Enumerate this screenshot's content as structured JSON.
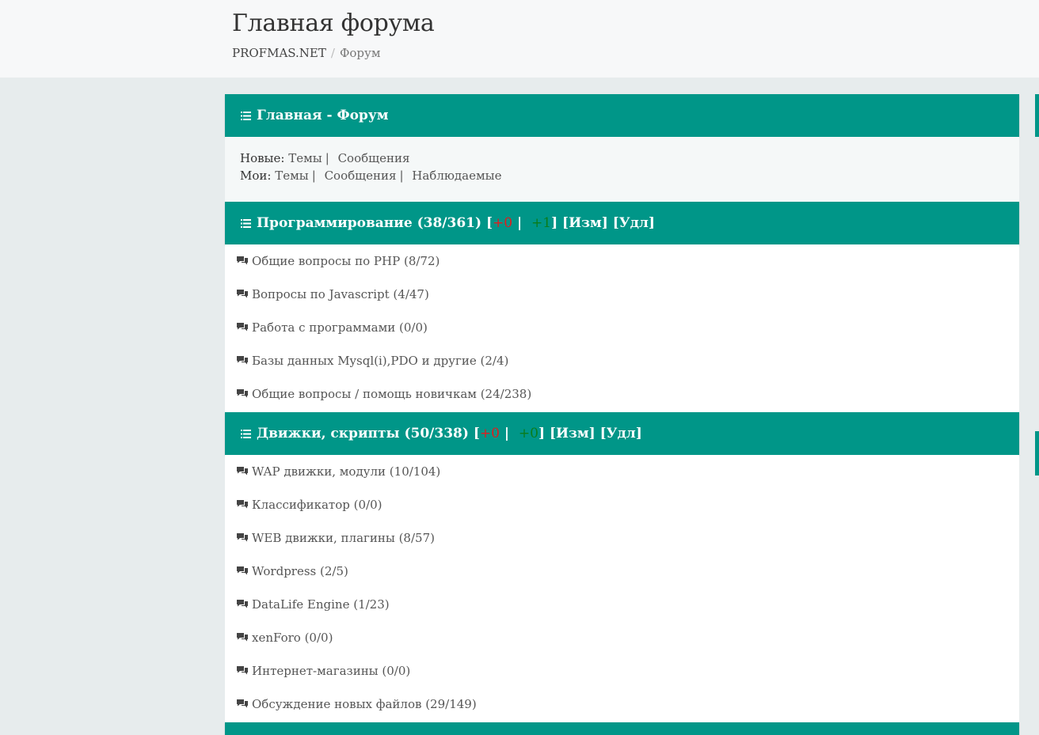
{
  "header": {
    "title": "Главная форума",
    "breadcrumb": {
      "root": "PROFMAS.NET",
      "sep": "/",
      "current": "Форум"
    }
  },
  "main_panel": {
    "title": "Главная - Форум",
    "new_label": "Новые:",
    "new_links": [
      "Темы",
      "Сообщения"
    ],
    "my_label": "Мои:",
    "my_links": [
      "Темы",
      "Сообщения",
      "Наблюдаемые"
    ]
  },
  "categories": [
    {
      "title": "Программирование (38/361)",
      "plus_red": "+0",
      "plus_green": "+1",
      "edit": "[Изм]",
      "delete": "[Удл]",
      "forums": [
        "Общие вопросы по PHP (8/72)",
        "Вопросы по Javascript (4/47)",
        "Работа с программами (0/0)",
        "Базы данных Mysql(i),PDO и другие (2/4)",
        "Общие вопросы / помощь новичкам (24/238)"
      ]
    },
    {
      "title": "Движки, скрипты (50/338)",
      "plus_red": "+0",
      "plus_green": "+0",
      "edit": "[Изм]",
      "delete": "[Удл]",
      "forums": [
        "WAP движки, модули (10/104)",
        "Классификатор (0/0)",
        "WEB движки, плагины (8/57)",
        "Wordpress (2/5)",
        "DataLife Engine (1/23)",
        "xenForo (0/0)",
        "Интернет-магазины (0/0)",
        "Обсуждение новых файлов (29/149)"
      ]
    }
  ],
  "colors": {
    "accent": "#009688",
    "red": "#e21d1d",
    "green": "#0a7c1b"
  },
  "icons": {
    "header": "list-icon",
    "forum": "chat-bubbles-icon"
  }
}
